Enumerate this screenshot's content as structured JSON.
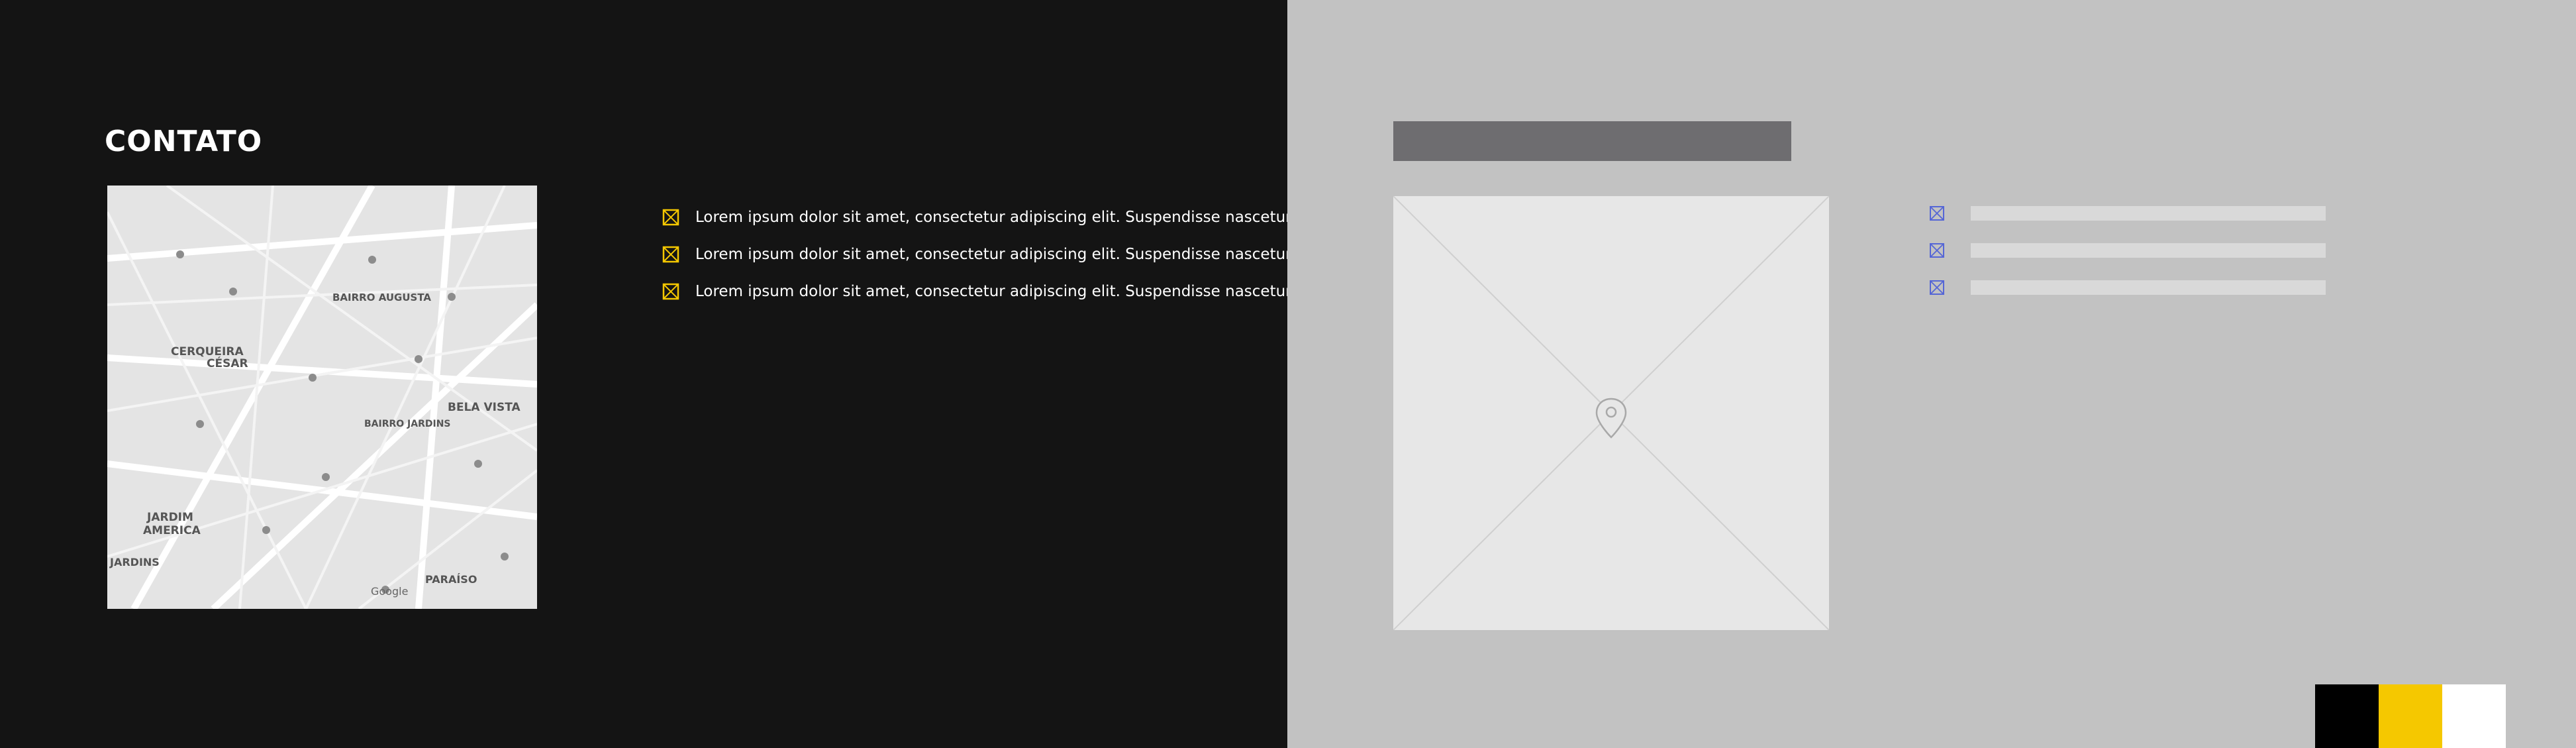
{
  "contact": {
    "title": "CONTATO",
    "items": [
      {
        "text": "Lorem ipsum dolor sit amet, consectetur adipiscing elit. Suspendisse nascetur",
        "icon": "placeholder-icon"
      },
      {
        "text": "Lorem ipsum dolor sit amet, consectetur adipiscing elit. Suspendisse nascetur",
        "icon": "placeholder-icon"
      },
      {
        "text": "Lorem ipsum dolor sit amet, consectetur adipiscing elit. Suspendisse nascetur",
        "icon": "placeholder-icon"
      }
    ]
  },
  "map": {
    "labels": {
      "cerqueira": "CERQUEIRA",
      "cesar": "CÉSAR",
      "bairro_augusta": "BAIRRO AUGUSTA",
      "bela_vista": "BELA VISTA",
      "bairro_jardins": "BAIRRO JARDINS",
      "jardim": "JARDIM",
      "america": "AMERICA",
      "jardins": "JARDINS",
      "paraiso": "PARAÍSO",
      "google": "Google"
    }
  },
  "wireframe": {
    "pin_icon": "location-pin-icon",
    "list_icon": "placeholder-icon",
    "item_count": 3
  },
  "palette": {
    "swatches": [
      "#000000",
      "#f5c800",
      "#ffffff"
    ],
    "accent_yellow": "#f5c800",
    "wireframe_blue": "#5566d6"
  }
}
